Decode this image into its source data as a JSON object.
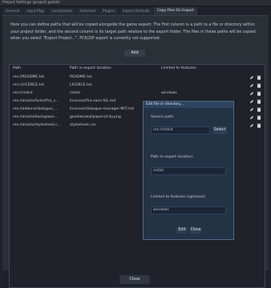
{
  "window": {
    "title": "Project Settings (project.godot)"
  },
  "tabs": [
    {
      "label": "General"
    },
    {
      "label": "Input Map"
    },
    {
      "label": "Localization"
    },
    {
      "label": "Autoload"
    },
    {
      "label": "Plugins"
    },
    {
      "label": "Import Defaults"
    },
    {
      "label": "Copy Files On Export",
      "active": true
    }
  ],
  "description": {
    "line1": "Here you can define paths that will be copied alongside the game export. The first column is a path to a file or directory within",
    "line2": "your project folder, and the second column is its target path relative to the export folder. The files in these paths will be copied",
    "line3": "when you select \"Export Project...\". PCK/ZIP export is currently not supported."
  },
  "add_button": {
    "label": "Add"
  },
  "table": {
    "headers": {
      "path": "Path",
      "export_location": "Path in export location",
      "features": "Limited to features"
    },
    "rows": [
      {
        "path": "res://README.txt",
        "export": "README.txt",
        "features": ""
      },
      {
        "path": "res://LICENCE.txt",
        "export": "LICENCE.txt",
        "features": ""
      },
      {
        "path": "res://redist",
        "export": "redist",
        "features": "windows"
      },
      {
        "path": "res://assets/fonts/fira_s...",
        "export": "licenses/fira-sans-SIL.md",
        "features": ""
      },
      {
        "path": "res://addons/dialogue_...",
        "export": "licenses/dialogue-manager-MIT.md",
        "features": ""
      },
      {
        "path": "res://assets/backgroun...",
        "export": "goodies/wallpapers/city.png",
        "features": ""
      },
      {
        "path": "res://assets/stylesheet.c...",
        "export": "stylesheet.css",
        "features": ""
      }
    ]
  },
  "dialog": {
    "title": "Edit file or directory...",
    "source_label": "Source path:",
    "source_value": "res://redist",
    "select_label": "Select",
    "export_label": "Path in export location:",
    "export_value": "redist",
    "features_label": "Limited to features (optional):",
    "features_value": "windows",
    "edit_label": "Edit",
    "close_label": "Close"
  },
  "footer": {
    "close_label": "Close"
  },
  "colors": {
    "accent": "#4a6b8a",
    "panel": "#2b2f36",
    "background": "#1f2228"
  },
  "icons": {
    "edit": "pencil-icon",
    "delete": "trash-icon"
  }
}
